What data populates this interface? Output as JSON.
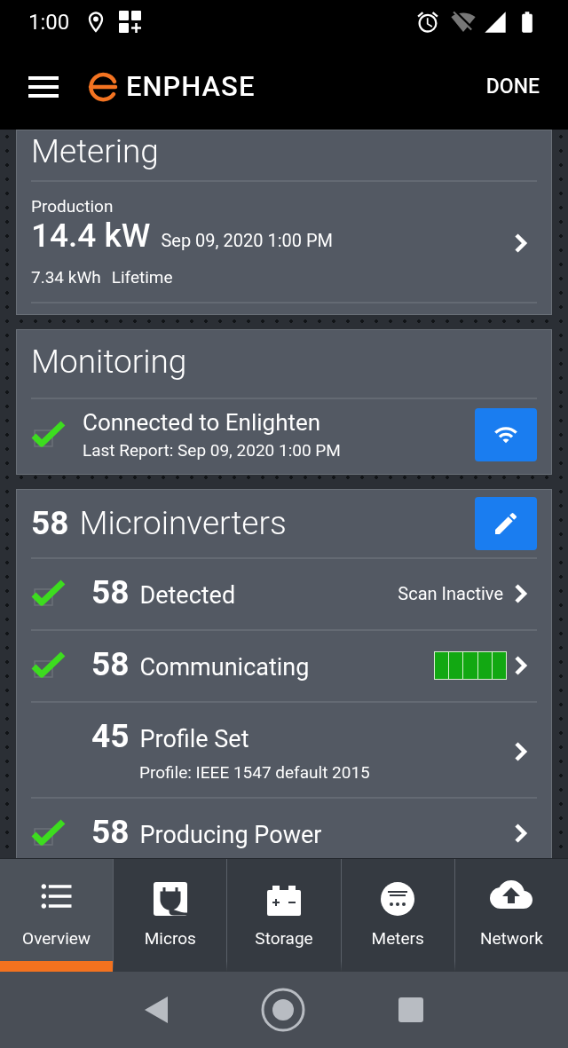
{
  "status_bar": {
    "time": "1:00"
  },
  "app_bar": {
    "logo_text": "ENPHASE",
    "action": "DONE"
  },
  "metering": {
    "title": "Metering",
    "label": "Production",
    "power": "14.4 kW",
    "timestamp": "Sep 09, 2020 1:00 PM",
    "lifetime_value": "7.34 kWh",
    "lifetime_label": "Lifetime"
  },
  "monitoring": {
    "title": "Monitoring",
    "checked": true,
    "status": "Connected to Enlighten",
    "last_report": "Last Report: Sep 09, 2020 1:00 PM"
  },
  "microinverters": {
    "count": "58",
    "title": "Microinverters",
    "rows": [
      {
        "checked": true,
        "count": "58",
        "label": "Detected",
        "status": "Scan Inactive"
      },
      {
        "checked": true,
        "count": "58",
        "label": "Communicating",
        "level": 1
      },
      {
        "checked": false,
        "count": "45",
        "label": "Profile Set",
        "subtitle": "Profile: IEEE 1547 default 2015"
      },
      {
        "checked": true,
        "count": "58",
        "label": "Producing Power"
      }
    ]
  },
  "tabs": [
    {
      "kind": "overview",
      "label": "Overview",
      "selected": true
    },
    {
      "kind": "micros",
      "label": "Micros",
      "selected": false
    },
    {
      "kind": "storage",
      "label": "Storage",
      "selected": false
    },
    {
      "kind": "meters",
      "label": "Meters",
      "selected": false
    },
    {
      "kind": "network",
      "label": "Network",
      "selected": false
    }
  ]
}
